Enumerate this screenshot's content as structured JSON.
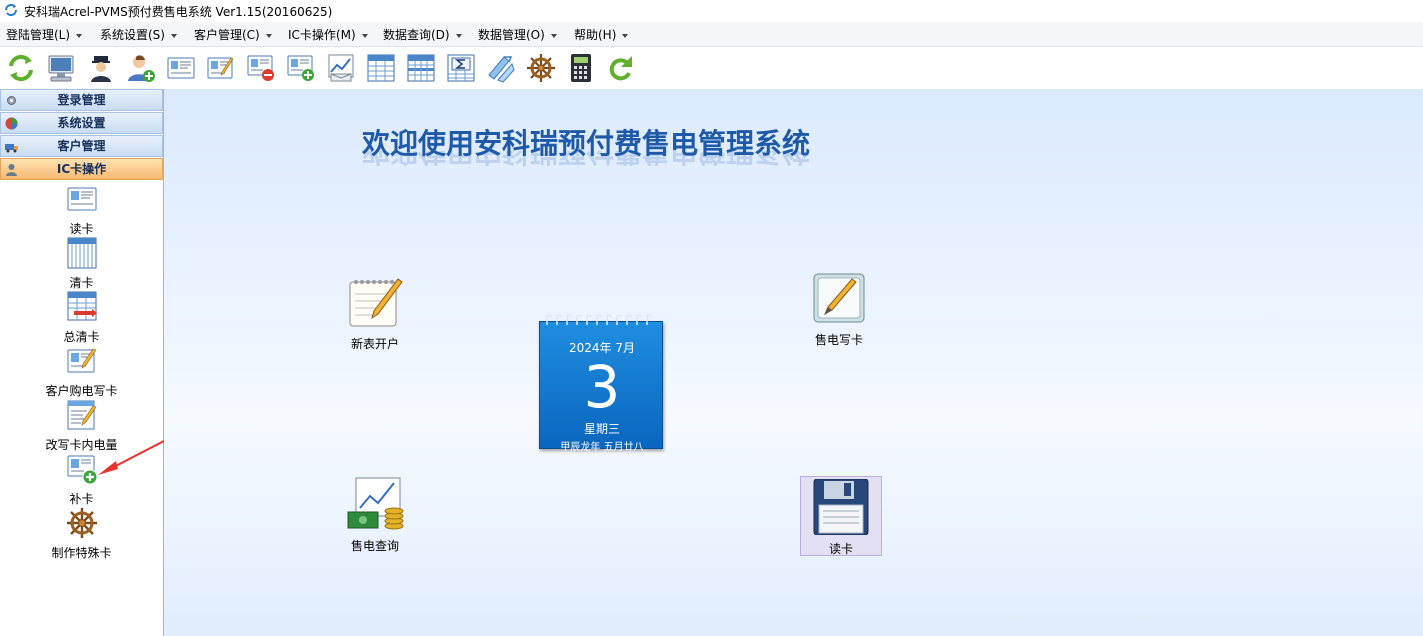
{
  "window": {
    "title": "安科瑞Acrel-PVMS预付费售电系统 Ver1.15(20160625)"
  },
  "menu": [
    {
      "label": "登陆管理(L)"
    },
    {
      "label": "系统设置(S)"
    },
    {
      "label": "客户管理(C)"
    },
    {
      "label": "IC卡操作(M)"
    },
    {
      "label": "数据查询(D)"
    },
    {
      "label": "数据管理(O)"
    },
    {
      "label": "帮助(H)"
    }
  ],
  "toolbar": [
    {
      "icon": "refresh-icon"
    },
    {
      "icon": "computer-icon"
    },
    {
      "icon": "police-user-icon"
    },
    {
      "icon": "add-user-icon"
    },
    {
      "icon": "read-card-icon"
    },
    {
      "icon": "write-card-icon"
    },
    {
      "icon": "remove-card-icon"
    },
    {
      "icon": "add-card-icon"
    },
    {
      "icon": "chart-mail-icon"
    },
    {
      "icon": "table-icon"
    },
    {
      "icon": "grid-table-icon"
    },
    {
      "icon": "sigma-table-icon"
    },
    {
      "icon": "exchange-icon"
    },
    {
      "icon": "ship-wheel-icon"
    },
    {
      "icon": "calculator-icon"
    },
    {
      "icon": "redo-arrow-icon"
    }
  ],
  "sidebar": {
    "sections": [
      {
        "label": "登录管理"
      },
      {
        "label": "系统设置"
      },
      {
        "label": "客户管理"
      },
      {
        "label": "IC卡操作"
      }
    ],
    "items": [
      {
        "label": "读卡"
      },
      {
        "label": "清卡"
      },
      {
        "label": "总清卡"
      },
      {
        "label": "客户购电写卡"
      },
      {
        "label": "改写卡内电量"
      },
      {
        "label": "补卡"
      },
      {
        "label": "制作特殊卡"
      }
    ]
  },
  "main": {
    "welcome": "欢迎使用安科瑞预付费售电管理系统",
    "shortcuts": {
      "new_meter": "新表开户",
      "sell_write": "售电写卡",
      "sell_query": "售电查询",
      "read_card": "读卡"
    },
    "calendar": {
      "year_month": "2024年  7月",
      "day": "3",
      "weekday": "星期三",
      "lunar": "甲辰龙年  五月廿八"
    }
  },
  "colors": {
    "accent": "#1e5aa8",
    "calendar": "#1182d8",
    "active_section": "#f9b870",
    "arrow": "#e8322c"
  }
}
